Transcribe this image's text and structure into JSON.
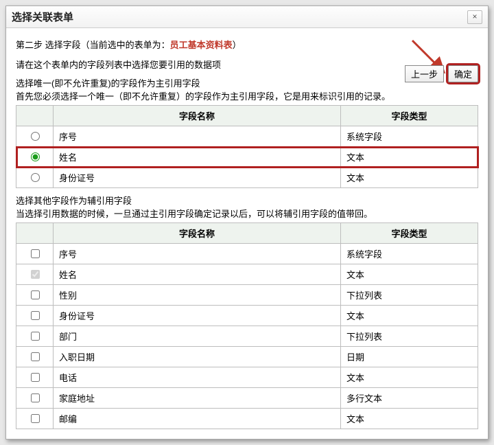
{
  "dialog": {
    "title": "选择关联表单",
    "close": "×"
  },
  "step": {
    "prefix": "第二步 选择字段（当前选中的表单为：",
    "form_name": "员工基本资料表",
    "suffix": "）"
  },
  "instruction": "请在这个表单内的字段列表中选择您要引用的数据项",
  "buttons": {
    "prev": "上一步",
    "ok": "确定"
  },
  "primary": {
    "title": "选择唯一(即不允许重复)的字段作为主引用字段",
    "sub": "首先您必须选择一个唯一（即不允许重复）的字段作为主引用字段，它是用来标识引用的记录。",
    "headers": {
      "name": "字段名称",
      "type": "字段类型"
    },
    "rows": [
      {
        "name": "序号",
        "type": "系统字段",
        "selected": false,
        "highlight": false
      },
      {
        "name": "姓名",
        "type": "文本",
        "selected": true,
        "highlight": true
      },
      {
        "name": "身份证号",
        "type": "文本",
        "selected": false,
        "highlight": false
      }
    ]
  },
  "aux": {
    "title": "选择其他字段作为辅引用字段",
    "sub": "当选择引用数据的时候，一旦通过主引用字段确定记录以后，可以将辅引用字段的值带回。",
    "headers": {
      "name": "字段名称",
      "type": "字段类型"
    },
    "rows": [
      {
        "name": "序号",
        "type": "系统字段",
        "checked": false,
        "disabled": false
      },
      {
        "name": "姓名",
        "type": "文本",
        "checked": true,
        "disabled": true
      },
      {
        "name": "性别",
        "type": "下拉列表",
        "checked": false,
        "disabled": false
      },
      {
        "name": "身份证号",
        "type": "文本",
        "checked": false,
        "disabled": false
      },
      {
        "name": "部门",
        "type": "下拉列表",
        "checked": false,
        "disabled": false
      },
      {
        "name": "入职日期",
        "type": "日期",
        "checked": false,
        "disabled": false
      },
      {
        "name": "电话",
        "type": "文本",
        "checked": false,
        "disabled": false
      },
      {
        "name": "家庭地址",
        "type": "多行文本",
        "checked": false,
        "disabled": false
      },
      {
        "name": "邮编",
        "type": "文本",
        "checked": false,
        "disabled": false
      }
    ]
  }
}
